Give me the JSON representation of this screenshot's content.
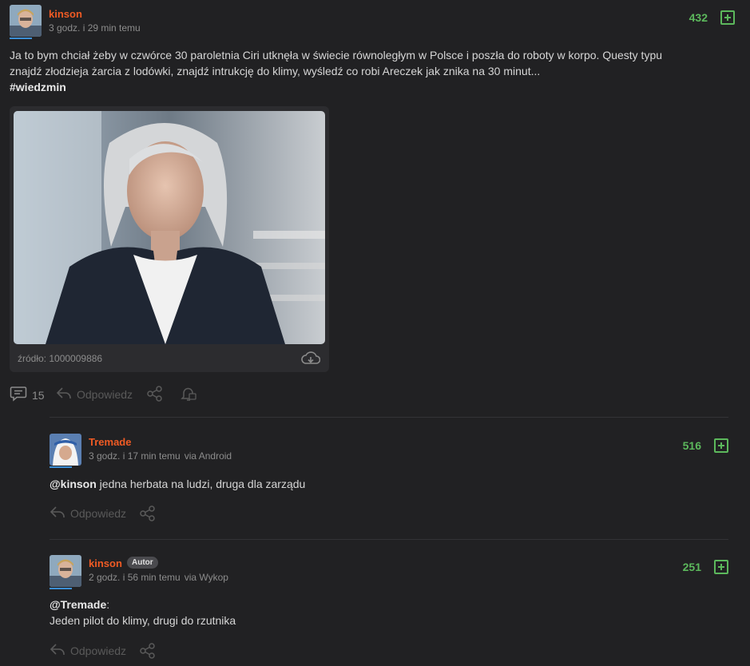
{
  "post": {
    "username": "kinson",
    "time": "3 godz. i 29 min temu",
    "score": "432",
    "text_line1": "Ja to bym chciał żeby w czwórce 30 paroletnia Ciri utknęła w świecie równoległym w Polsce i poszła do roboty w korpo. Questy typu",
    "text_line2": "znajdź złodzieja żarcia z lodówki, znajdź intrukcję do klimy, wyśledź co robi Areczek jak znika na 30 minut...",
    "hashtag": "#wiedzmin",
    "source": "źródło: 1000009886",
    "comment_count": "15",
    "reply_label": "Odpowiedz"
  },
  "comments": [
    {
      "username": "Tremade",
      "time": "3 godz. i 17 min temu",
      "via": "via Android",
      "score": "516",
      "mention": "@kinson",
      "text": " jedna herbata na ludzi, druga dla zarządu",
      "reply_label": "Odpowiedz"
    },
    {
      "username": "kinson",
      "badge": "Autor",
      "time": "2 godz. i 56 min temu",
      "via": "via Wykop",
      "score": "251",
      "mention": "@Tremade",
      "mention_suffix": ":",
      "text": "Jeden pilot do klimy, drugi do rzutnika",
      "reply_label": "Odpowiedz"
    }
  ],
  "colors": {
    "username": "#f05b24",
    "score": "#5cb85c",
    "background": "#212123"
  },
  "icons": [
    "comments-icon",
    "reply-icon",
    "share-icon",
    "notification-icon",
    "download-cloud-icon",
    "plus-vote-icon"
  ]
}
